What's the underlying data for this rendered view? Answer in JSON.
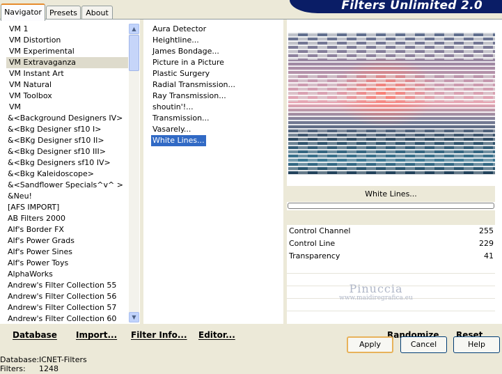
{
  "tabs": [
    {
      "label": "Navigator",
      "active": true
    },
    {
      "label": "Presets",
      "active": false
    },
    {
      "label": "About",
      "active": false
    }
  ],
  "app_title": "Filters Unlimited 2.0",
  "categories": [
    {
      "label": "VM 1"
    },
    {
      "label": "VM Distortion"
    },
    {
      "label": "VM Experimental"
    },
    {
      "label": "VM Extravaganza",
      "selected": true
    },
    {
      "label": "VM Instant Art"
    },
    {
      "label": "VM Natural"
    },
    {
      "label": "VM Toolbox"
    },
    {
      "label": "VM"
    },
    {
      "label": "&<Background Designers IV>"
    },
    {
      "label": "&<Bkg Designer sf10 I>"
    },
    {
      "label": "&<BKg Designer sf10 II>"
    },
    {
      "label": "&<Bkg Designer sf10 III>"
    },
    {
      "label": "&<Bkg Designers sf10 IV>"
    },
    {
      "label": "&<Bkg Kaleidoscope>"
    },
    {
      "label": "&<Sandflower Specials^v^ >"
    },
    {
      "label": "&Neu!"
    },
    {
      "label": "[AFS IMPORT]"
    },
    {
      "label": "AB Filters 2000"
    },
    {
      "label": "Alf's Border FX"
    },
    {
      "label": "Alf's Power Grads"
    },
    {
      "label": "Alf's Power Sines"
    },
    {
      "label": "Alf's Power Toys"
    },
    {
      "label": "AlphaWorks"
    },
    {
      "label": "Andrew's Filter Collection 55"
    },
    {
      "label": "Andrew's Filter Collection 56"
    },
    {
      "label": "Andrew's Filter Collection 57"
    },
    {
      "label": "Andrew's Filter Collection 60"
    }
  ],
  "filters": [
    {
      "label": " Aura Detector"
    },
    {
      "label": "Heightline..."
    },
    {
      "label": "James Bondage..."
    },
    {
      "label": "Picture in a Picture"
    },
    {
      "label": "Plastic Surgery"
    },
    {
      "label": "Radial Transmission..."
    },
    {
      "label": "Ray Transmission..."
    },
    {
      "label": "shoutin'!..."
    },
    {
      "label": "Transmission..."
    },
    {
      "label": "Vasarely..."
    },
    {
      "label": "White Lines...",
      "selected": true
    }
  ],
  "preview": {
    "filter_name": "White Lines..."
  },
  "controls": [
    {
      "name": "Control Channel",
      "value": "255"
    },
    {
      "name": "Control Line",
      "value": "229"
    },
    {
      "name": "Transparency",
      "value": "41"
    }
  ],
  "watermark": {
    "name": "Pinuccia",
    "url": "www.maidiregrafica.eu"
  },
  "links": {
    "database": "Database",
    "import": "Import...",
    "filter_info": "Filter Info...",
    "editor": "Editor...",
    "randomize": "Randomize",
    "reset": "Reset"
  },
  "status": {
    "database_label": "Database:",
    "database_value": "ICNET-Filters",
    "filters_label": "Filters:",
    "filters_value": "1248"
  },
  "buttons": {
    "apply": "Apply",
    "cancel": "Cancel",
    "help": "Help"
  },
  "colors": {
    "banner": "#0a1d66",
    "selection": "#316ac5",
    "face": "#ece9d8"
  }
}
